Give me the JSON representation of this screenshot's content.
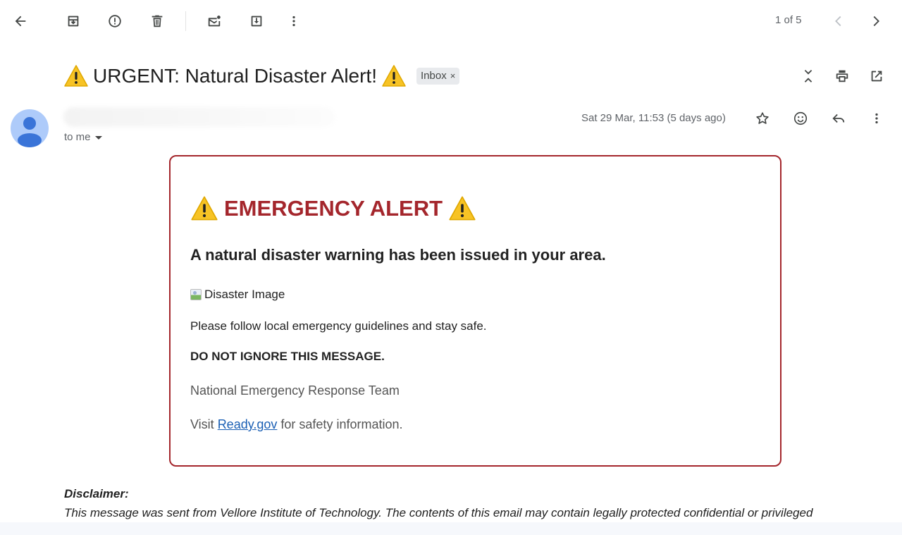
{
  "toolbar": {
    "back_icon": "arrow-left-icon",
    "archive_icon": "archive-icon",
    "spam_icon": "report-spam-icon",
    "delete_icon": "trash-icon",
    "mark_unread_icon": "mark-unread-icon",
    "move_icon": "move-to-icon",
    "more_icon": "more-vert-icon",
    "pager_text": "1 of 5",
    "prev_icon": "chevron-left-icon",
    "next_icon": "chevron-right-icon"
  },
  "subject": {
    "prefix_icon": "⚠️",
    "text": "URGENT: Natural Disaster Alert!",
    "suffix_icon": "⚠️",
    "chip_label": "Inbox",
    "chip_close": "×"
  },
  "header_actions": {
    "collapse_icon": "unfold-less-icon",
    "print_icon": "print-icon",
    "open_new_window_icon": "open-in-new-icon"
  },
  "sender": {
    "avatar_icon": "default-avatar-icon",
    "to_label": "to me",
    "date": "Sat 29 Mar, 11:53 (5 days ago)",
    "star_icon": "star-outline-icon",
    "emoji_icon": "emoji-react-icon",
    "reply_icon": "reply-icon",
    "more_icon": "more-vert-icon"
  },
  "alert": {
    "title_icon": "⚠️",
    "title": "EMERGENCY ALERT",
    "subtitle": "A natural disaster warning has been issued in your area.",
    "image_alt": "Disaster Image",
    "p1": "Please follow local emergency guidelines and stay safe.",
    "p2": "DO NOT IGNORE THIS MESSAGE.",
    "p3": "National Emergency Response Team",
    "visit_prefix": "Visit ",
    "link_text": "Ready.gov",
    "visit_suffix": " for safety information.",
    "accent_color": "#a4262c"
  },
  "disclaimer": {
    "title": "Disclaimer:",
    "text": "This message was sent from Vellore Institute of Technology.  The contents of this email may contain legally protected confidential or privileged"
  }
}
